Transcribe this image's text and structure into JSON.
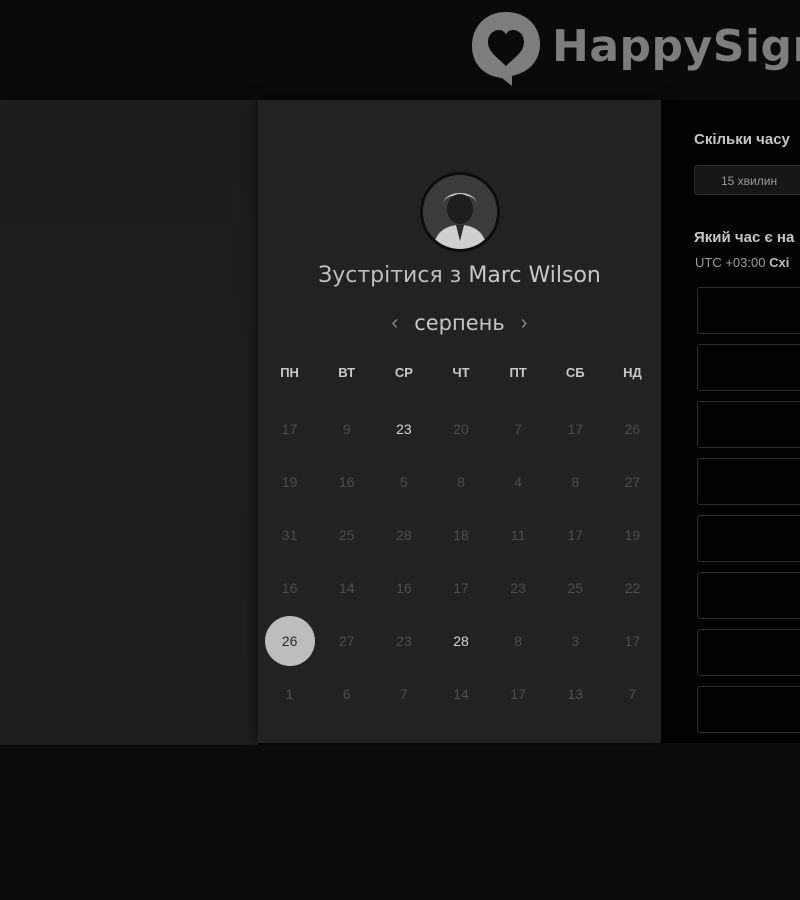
{
  "brand": {
    "name": "HappySigna",
    "icon": "heart-chat-bubble-icon"
  },
  "calendar": {
    "title_prefix": "Зустрітися з",
    "host_name": "Marc Wilson",
    "month": "серпень",
    "prev_icon": "chevron-left-icon",
    "next_icon": "chevron-right-icon",
    "weekdays": [
      "ПН",
      "ВТ",
      "СР",
      "ЧТ",
      "ПТ",
      "СБ",
      "НД"
    ],
    "weeks": [
      [
        {
          "d": "17"
        },
        {
          "d": "9"
        },
        {
          "d": "23",
          "available": true
        },
        {
          "d": "20"
        },
        {
          "d": "7"
        },
        {
          "d": "17"
        },
        {
          "d": "26"
        }
      ],
      [
        {
          "d": "19"
        },
        {
          "d": "16"
        },
        {
          "d": "5"
        },
        {
          "d": "8"
        },
        {
          "d": "4"
        },
        {
          "d": "8"
        },
        {
          "d": "27"
        }
      ],
      [
        {
          "d": "31"
        },
        {
          "d": "25"
        },
        {
          "d": "28"
        },
        {
          "d": "18"
        },
        {
          "d": "11"
        },
        {
          "d": "17"
        },
        {
          "d": "19"
        }
      ],
      [
        {
          "d": "16"
        },
        {
          "d": "14"
        },
        {
          "d": "16"
        },
        {
          "d": "17"
        },
        {
          "d": "23"
        },
        {
          "d": "25"
        },
        {
          "d": "22"
        }
      ],
      [
        {
          "d": "26",
          "selected": true
        },
        {
          "d": "27"
        },
        {
          "d": "23"
        },
        {
          "d": "28",
          "available": true
        },
        {
          "d": "8"
        },
        {
          "d": "3"
        },
        {
          "d": "17"
        }
      ],
      [
        {
          "d": "1"
        },
        {
          "d": "6"
        },
        {
          "d": "7"
        },
        {
          "d": "14"
        },
        {
          "d": "17"
        },
        {
          "d": "13"
        },
        {
          "d": "7"
        }
      ]
    ]
  },
  "scheduler": {
    "duration_question": "Скільки часу",
    "duration_value": "15 хвилин",
    "time_question": "Який час є на",
    "timezone_prefix": "UTC +03:00",
    "timezone_name": "Схі",
    "slot_count": 8
  },
  "colors": {
    "selected_day": "#bdbdbd",
    "card": "#222222",
    "panel": "#020202"
  }
}
